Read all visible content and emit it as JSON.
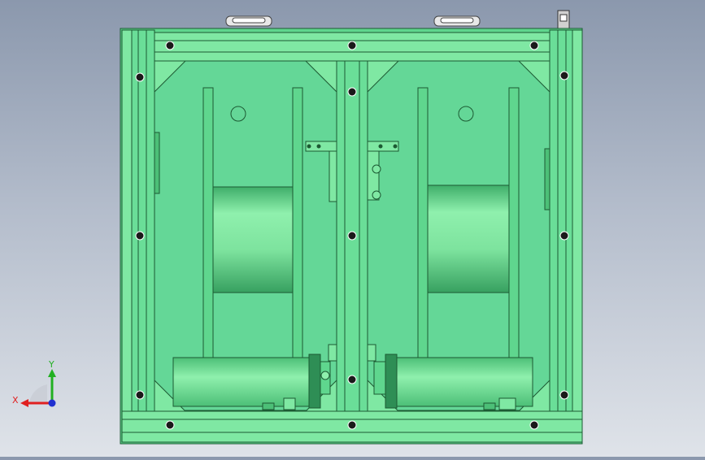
{
  "viewport": {
    "background_top": "#8b98ad",
    "background_bottom": "#dfe3e9",
    "model_fill": "#5fd68e",
    "model_fill_light": "#9af5b4",
    "model_edge": "#1c5a33"
  },
  "triad": {
    "x_label": "X",
    "y_label": "Y",
    "x_color": "#e02020",
    "y_color": "#22b022",
    "z_color": "#2030d0",
    "icons": [
      "view-orientation-triad-icon"
    ]
  }
}
